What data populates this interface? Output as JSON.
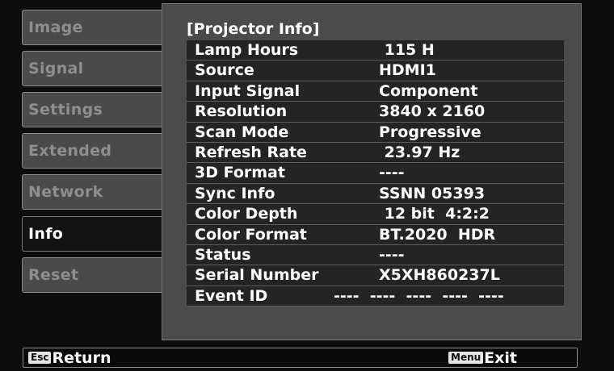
{
  "sidebar": {
    "items": [
      {
        "label": "Image"
      },
      {
        "label": "Signal"
      },
      {
        "label": "Settings"
      },
      {
        "label": "Extended"
      },
      {
        "label": "Network"
      },
      {
        "label": "Info"
      },
      {
        "label": "Reset"
      }
    ],
    "active": "Info"
  },
  "panel": {
    "title": "[Projector Info]",
    "rows": [
      {
        "label": "Lamp Hours",
        "value": " 115 H"
      },
      {
        "label": "Source",
        "value": "HDMI1"
      },
      {
        "label": "Input Signal",
        "value": "Component"
      },
      {
        "label": "Resolution",
        "value": "3840 x 2160"
      },
      {
        "label": "Scan Mode",
        "value": "Progressive"
      },
      {
        "label": "Refresh Rate",
        "value": " 23.97 Hz"
      },
      {
        "label": "3D Format",
        "value": "----"
      },
      {
        "label": "Sync Info",
        "value": "SSNN 05393"
      },
      {
        "label": "Color Depth",
        "value": " 12 bit  4:2:2"
      },
      {
        "label": "Color Format",
        "value": "BT.2020  HDR"
      },
      {
        "label": "Status",
        "value": "----"
      },
      {
        "label": "Serial Number",
        "value": "X5XH860237L"
      },
      {
        "label": "Event ID",
        "value": "----  ----  ----  ----  ----"
      }
    ]
  },
  "footer": {
    "return": {
      "key": "Esc",
      "label": "Return"
    },
    "exit": {
      "key": "Menu",
      "label": "Exit"
    }
  },
  "colors": {
    "panel_bg": "#4b4b4b",
    "row_bg": "#242424",
    "sidebar_item_bg": "#4a4a4a",
    "sidebar_active_bg": "#121212",
    "text": "#ffffff",
    "inactive_text": "#8e8e8e"
  }
}
